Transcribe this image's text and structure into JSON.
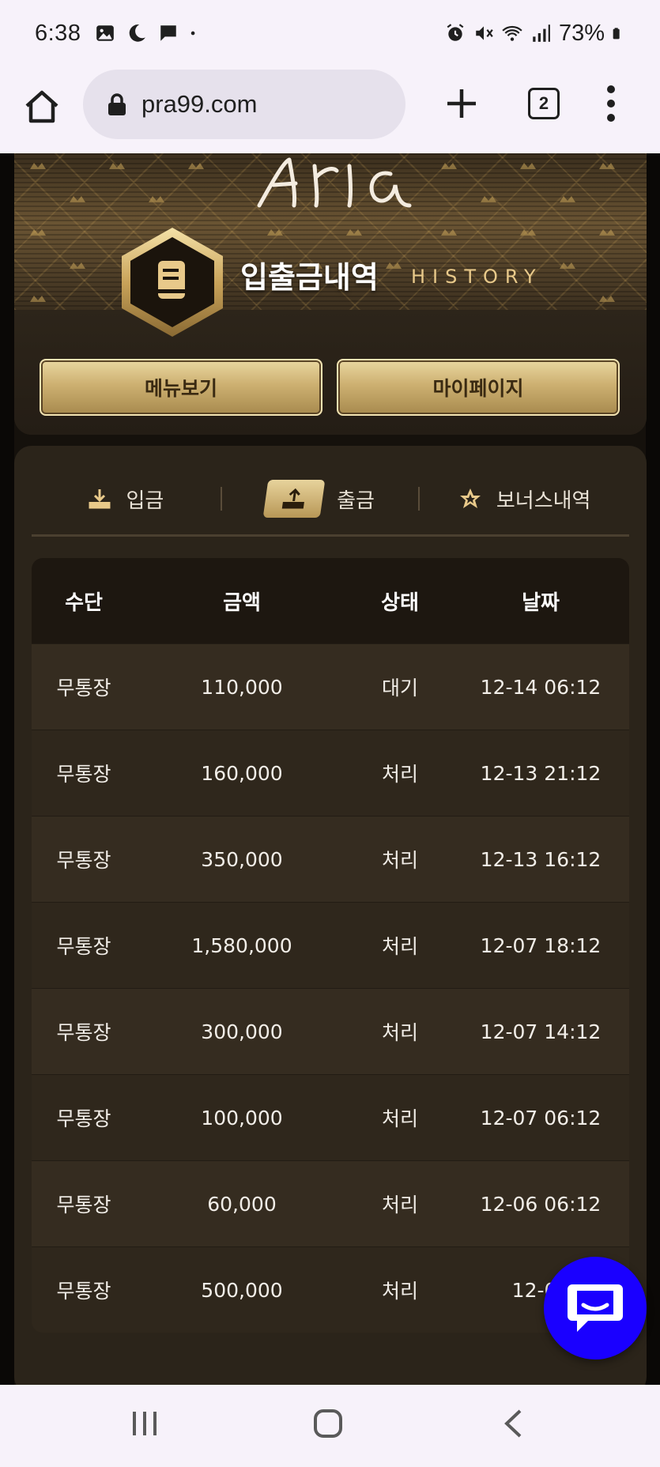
{
  "status_bar": {
    "time": "6:38",
    "battery": "73%",
    "icons_left": [
      "gallery-icon",
      "moon-icon",
      "chat-bubble-icon",
      "dot-icon"
    ],
    "icons_right": [
      "alarm-icon",
      "mute-icon",
      "wifi-icon",
      "signal-icon",
      "battery-icon"
    ]
  },
  "browser": {
    "url": "pra99.com",
    "tab_count": "2"
  },
  "header": {
    "title_ko": "입출금내역",
    "title_en": "HISTORY",
    "btn_menu": "메뉴보기",
    "btn_mypage": "마이페이지",
    "accent_color": "#d4b36e"
  },
  "tabs": [
    {
      "label": "입금",
      "icon": "download-icon",
      "active": false
    },
    {
      "label": "출금",
      "icon": "upload-icon",
      "active": true
    },
    {
      "label": "보너스내역",
      "icon": "star-icon",
      "active": false
    }
  ],
  "table": {
    "headers": [
      "수단",
      "금액",
      "상태",
      "날짜"
    ],
    "rows": [
      [
        "무통장",
        "110,000",
        "대기",
        "12-14 06:12"
      ],
      [
        "무통장",
        "160,000",
        "처리",
        "12-13 21:12"
      ],
      [
        "무통장",
        "350,000",
        "처리",
        "12-13 16:12"
      ],
      [
        "무통장",
        "1,580,000",
        "처리",
        "12-07 18:12"
      ],
      [
        "무통장",
        "300,000",
        "처리",
        "12-07 14:12"
      ],
      [
        "무통장",
        "100,000",
        "처리",
        "12-07 06:12"
      ],
      [
        "무통장",
        "60,000",
        "처리",
        "12-06 06:12"
      ],
      [
        "무통장",
        "500,000",
        "처리",
        "12-02"
      ]
    ]
  },
  "chat_button": {
    "icon": "chat-icon",
    "color": "#1a00ff"
  }
}
